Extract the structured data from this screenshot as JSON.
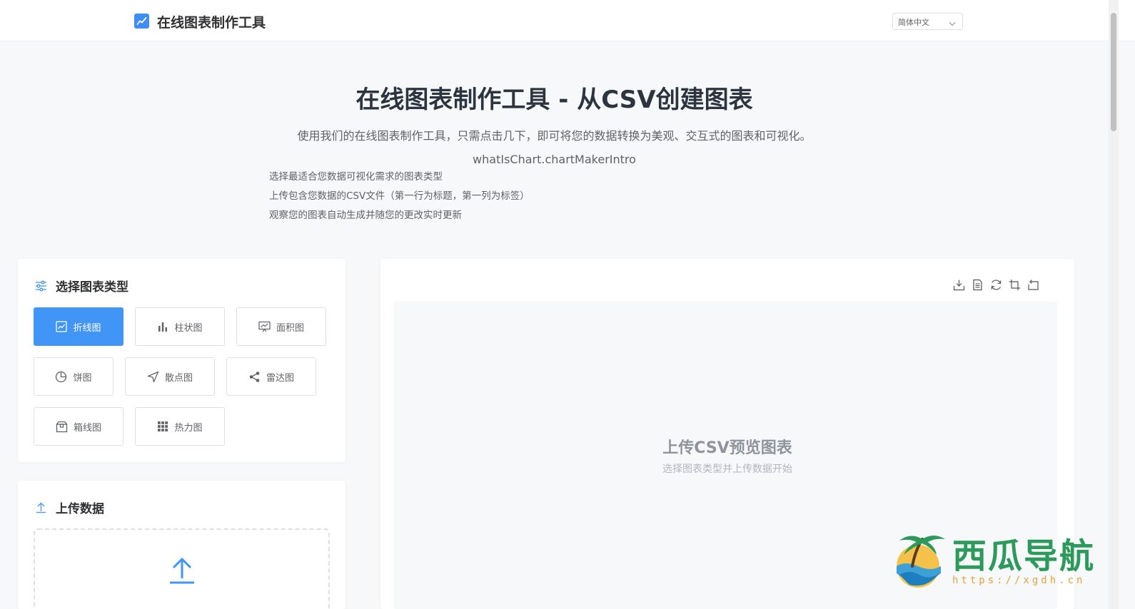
{
  "header": {
    "app_title": "在线图表制作工具",
    "language": "简体中文"
  },
  "hero": {
    "title": "在线图表制作工具 - 从CSV创建图表",
    "subtitle": "使用我们的在线图表制作工具，只需点击几下，即可将您的数据转换为美观、交互式的图表和可视化。",
    "intro_key": "whatIsChart.chartMakerIntro",
    "steps": [
      "选择最适合您数据可视化需求的图表类型",
      "上传包含您数据的CSV文件（第一行为标题，第一列为标签）",
      "观察您的图表自动生成并随您的更改实时更新"
    ]
  },
  "chart_type_panel": {
    "title": "选择图表类型",
    "selected": "折线图",
    "types": [
      {
        "label": "折线图",
        "icon": "line-chart-icon"
      },
      {
        "label": "柱状图",
        "icon": "bar-chart-icon"
      },
      {
        "label": "面积图",
        "icon": "area-chart-icon"
      },
      {
        "label": "饼图",
        "icon": "pie-chart-icon"
      },
      {
        "label": "散点图",
        "icon": "scatter-chart-icon"
      },
      {
        "label": "雷达图",
        "icon": "radar-chart-icon"
      },
      {
        "label": "箱线图",
        "icon": "box-plot-icon"
      },
      {
        "label": "热力图",
        "icon": "heatmap-icon"
      }
    ]
  },
  "upload_panel": {
    "title": "上传数据"
  },
  "preview": {
    "empty_title": "上传CSV预览图表",
    "empty_subtitle": "选择图表类型并上传数据开始",
    "tools": [
      "download-icon",
      "data-view-icon",
      "refresh-icon",
      "crop-icon",
      "restore-icon"
    ]
  },
  "watermark": {
    "brand": "西瓜导航",
    "url": "https://xgdh.cn"
  },
  "colors": {
    "accent": "#4095f6",
    "watermark_green": "#2b9a5a",
    "watermark_orange": "#e0a43a"
  }
}
